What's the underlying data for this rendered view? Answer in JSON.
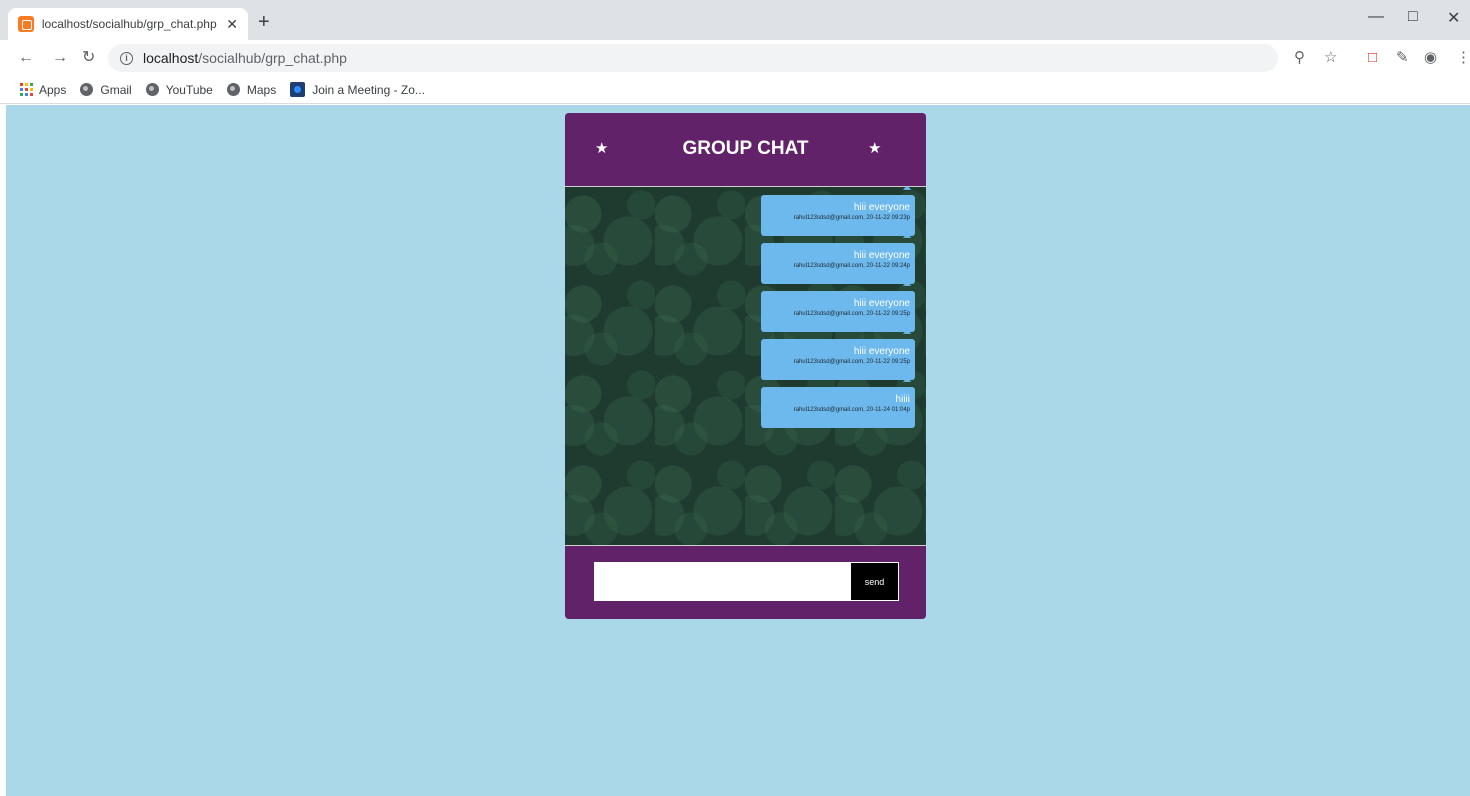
{
  "browser": {
    "tab_title": "localhost/socialhub/grp_chat.php",
    "tab_close": "✕",
    "new_tab": "+",
    "url_host": "localhost",
    "url_path": "/socialhub/grp_chat.php",
    "bookmarks": [
      {
        "label": "Apps",
        "icon": "apps-grid-icon"
      },
      {
        "label": "Gmail",
        "icon": "globe-icon"
      },
      {
        "label": "YouTube",
        "icon": "globe-icon"
      },
      {
        "label": "Maps",
        "icon": "globe-icon"
      },
      {
        "label": "Join a Meeting - Zo...",
        "icon": "zoom-icon"
      }
    ]
  },
  "chat": {
    "title": "GROUP CHAT",
    "messages": [
      {
        "text": "hiii everyone",
        "meta": "rahul123sdsd@gmail.com, 20-11-22 09:23p"
      },
      {
        "text": "hiii everyone",
        "meta": "rahul123sdsd@gmail.com, 20-11-22 09:24p"
      },
      {
        "text": "hiii everyone",
        "meta": "rahul123sdsd@gmail.com, 20-11-22 09:25p"
      },
      {
        "text": "hiii everyone",
        "meta": "rahul123sdsd@gmail.com, 20-11-22 09:25p"
      },
      {
        "text": "hiiii",
        "meta": "rahul123sdsd@gmail.com, 20-11-24 01:04p"
      }
    ],
    "input_value": "",
    "send_label": "send"
  },
  "colors": {
    "page_background": "#abd8e8",
    "header_purple": "#62226a",
    "bubble_blue": "#6db8ec",
    "send_button": "#000000"
  }
}
